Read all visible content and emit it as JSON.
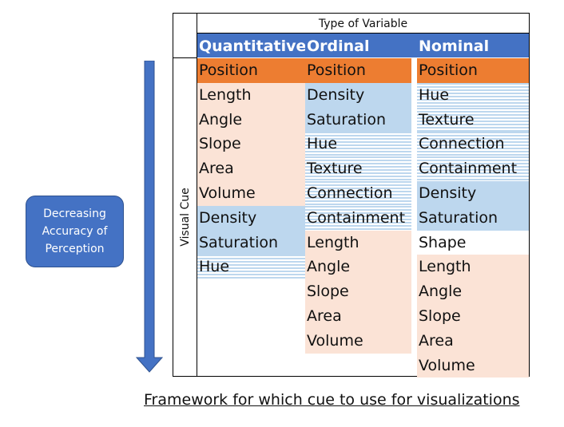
{
  "header": {
    "type_of_variable": "Type of Variable"
  },
  "row_header": {
    "visual_cue": "Visual Cue"
  },
  "colors": {
    "header_blue": "#4472c4",
    "position_orange": "#ed7d31",
    "quantitative_peach": "#fbe3d6",
    "ordinal_blue": "#bdd7ee"
  },
  "columns": [
    {
      "name": "Quantitative",
      "cells": [
        {
          "label": "Position",
          "style": "position"
        },
        {
          "label": "Length",
          "style": "peach"
        },
        {
          "label": "Angle",
          "style": "peach"
        },
        {
          "label": "Slope",
          "style": "peach"
        },
        {
          "label": "Area",
          "style": "peach"
        },
        {
          "label": "Volume",
          "style": "peach"
        },
        {
          "label": "Density",
          "style": "blue"
        },
        {
          "label": "Saturation",
          "style": "blue"
        },
        {
          "label": "Hue",
          "style": "striped"
        }
      ]
    },
    {
      "name": "Ordinal",
      "cells": [
        {
          "label": "Position",
          "style": "position"
        },
        {
          "label": "Density",
          "style": "blue"
        },
        {
          "label": "Saturation",
          "style": "blue"
        },
        {
          "label": "Hue",
          "style": "striped"
        },
        {
          "label": "Texture",
          "style": "striped"
        },
        {
          "label": "Connection",
          "style": "striped"
        },
        {
          "label": "Containment",
          "style": "striped"
        },
        {
          "label": "Length",
          "style": "peach"
        },
        {
          "label": "Angle",
          "style": "peach"
        },
        {
          "label": "Slope",
          "style": "peach"
        },
        {
          "label": "Area",
          "style": "peach"
        },
        {
          "label": "Volume",
          "style": "peach"
        }
      ]
    },
    {
      "name": "Nominal",
      "cells": [
        {
          "label": "Position",
          "style": "position"
        },
        {
          "label": "Hue",
          "style": "striped"
        },
        {
          "label": "Texture",
          "style": "striped"
        },
        {
          "label": "Connection",
          "style": "striped"
        },
        {
          "label": "Containment",
          "style": "striped"
        },
        {
          "label": "Density",
          "style": "blue"
        },
        {
          "label": "Saturation",
          "style": "blue"
        },
        {
          "label": "Shape",
          "style": "white"
        },
        {
          "label": "Length",
          "style": "peach"
        },
        {
          "label": "Angle",
          "style": "peach"
        },
        {
          "label": "Slope",
          "style": "peach"
        },
        {
          "label": "Area",
          "style": "peach"
        },
        {
          "label": "Volume",
          "style": "peach"
        }
      ]
    }
  ],
  "callout": {
    "lines": [
      "Decreasing",
      "Accuracy of",
      "Perception"
    ]
  },
  "arrow": {
    "icon": "down-arrow-icon"
  },
  "caption": "Framework for which cue to use for visualizations"
}
